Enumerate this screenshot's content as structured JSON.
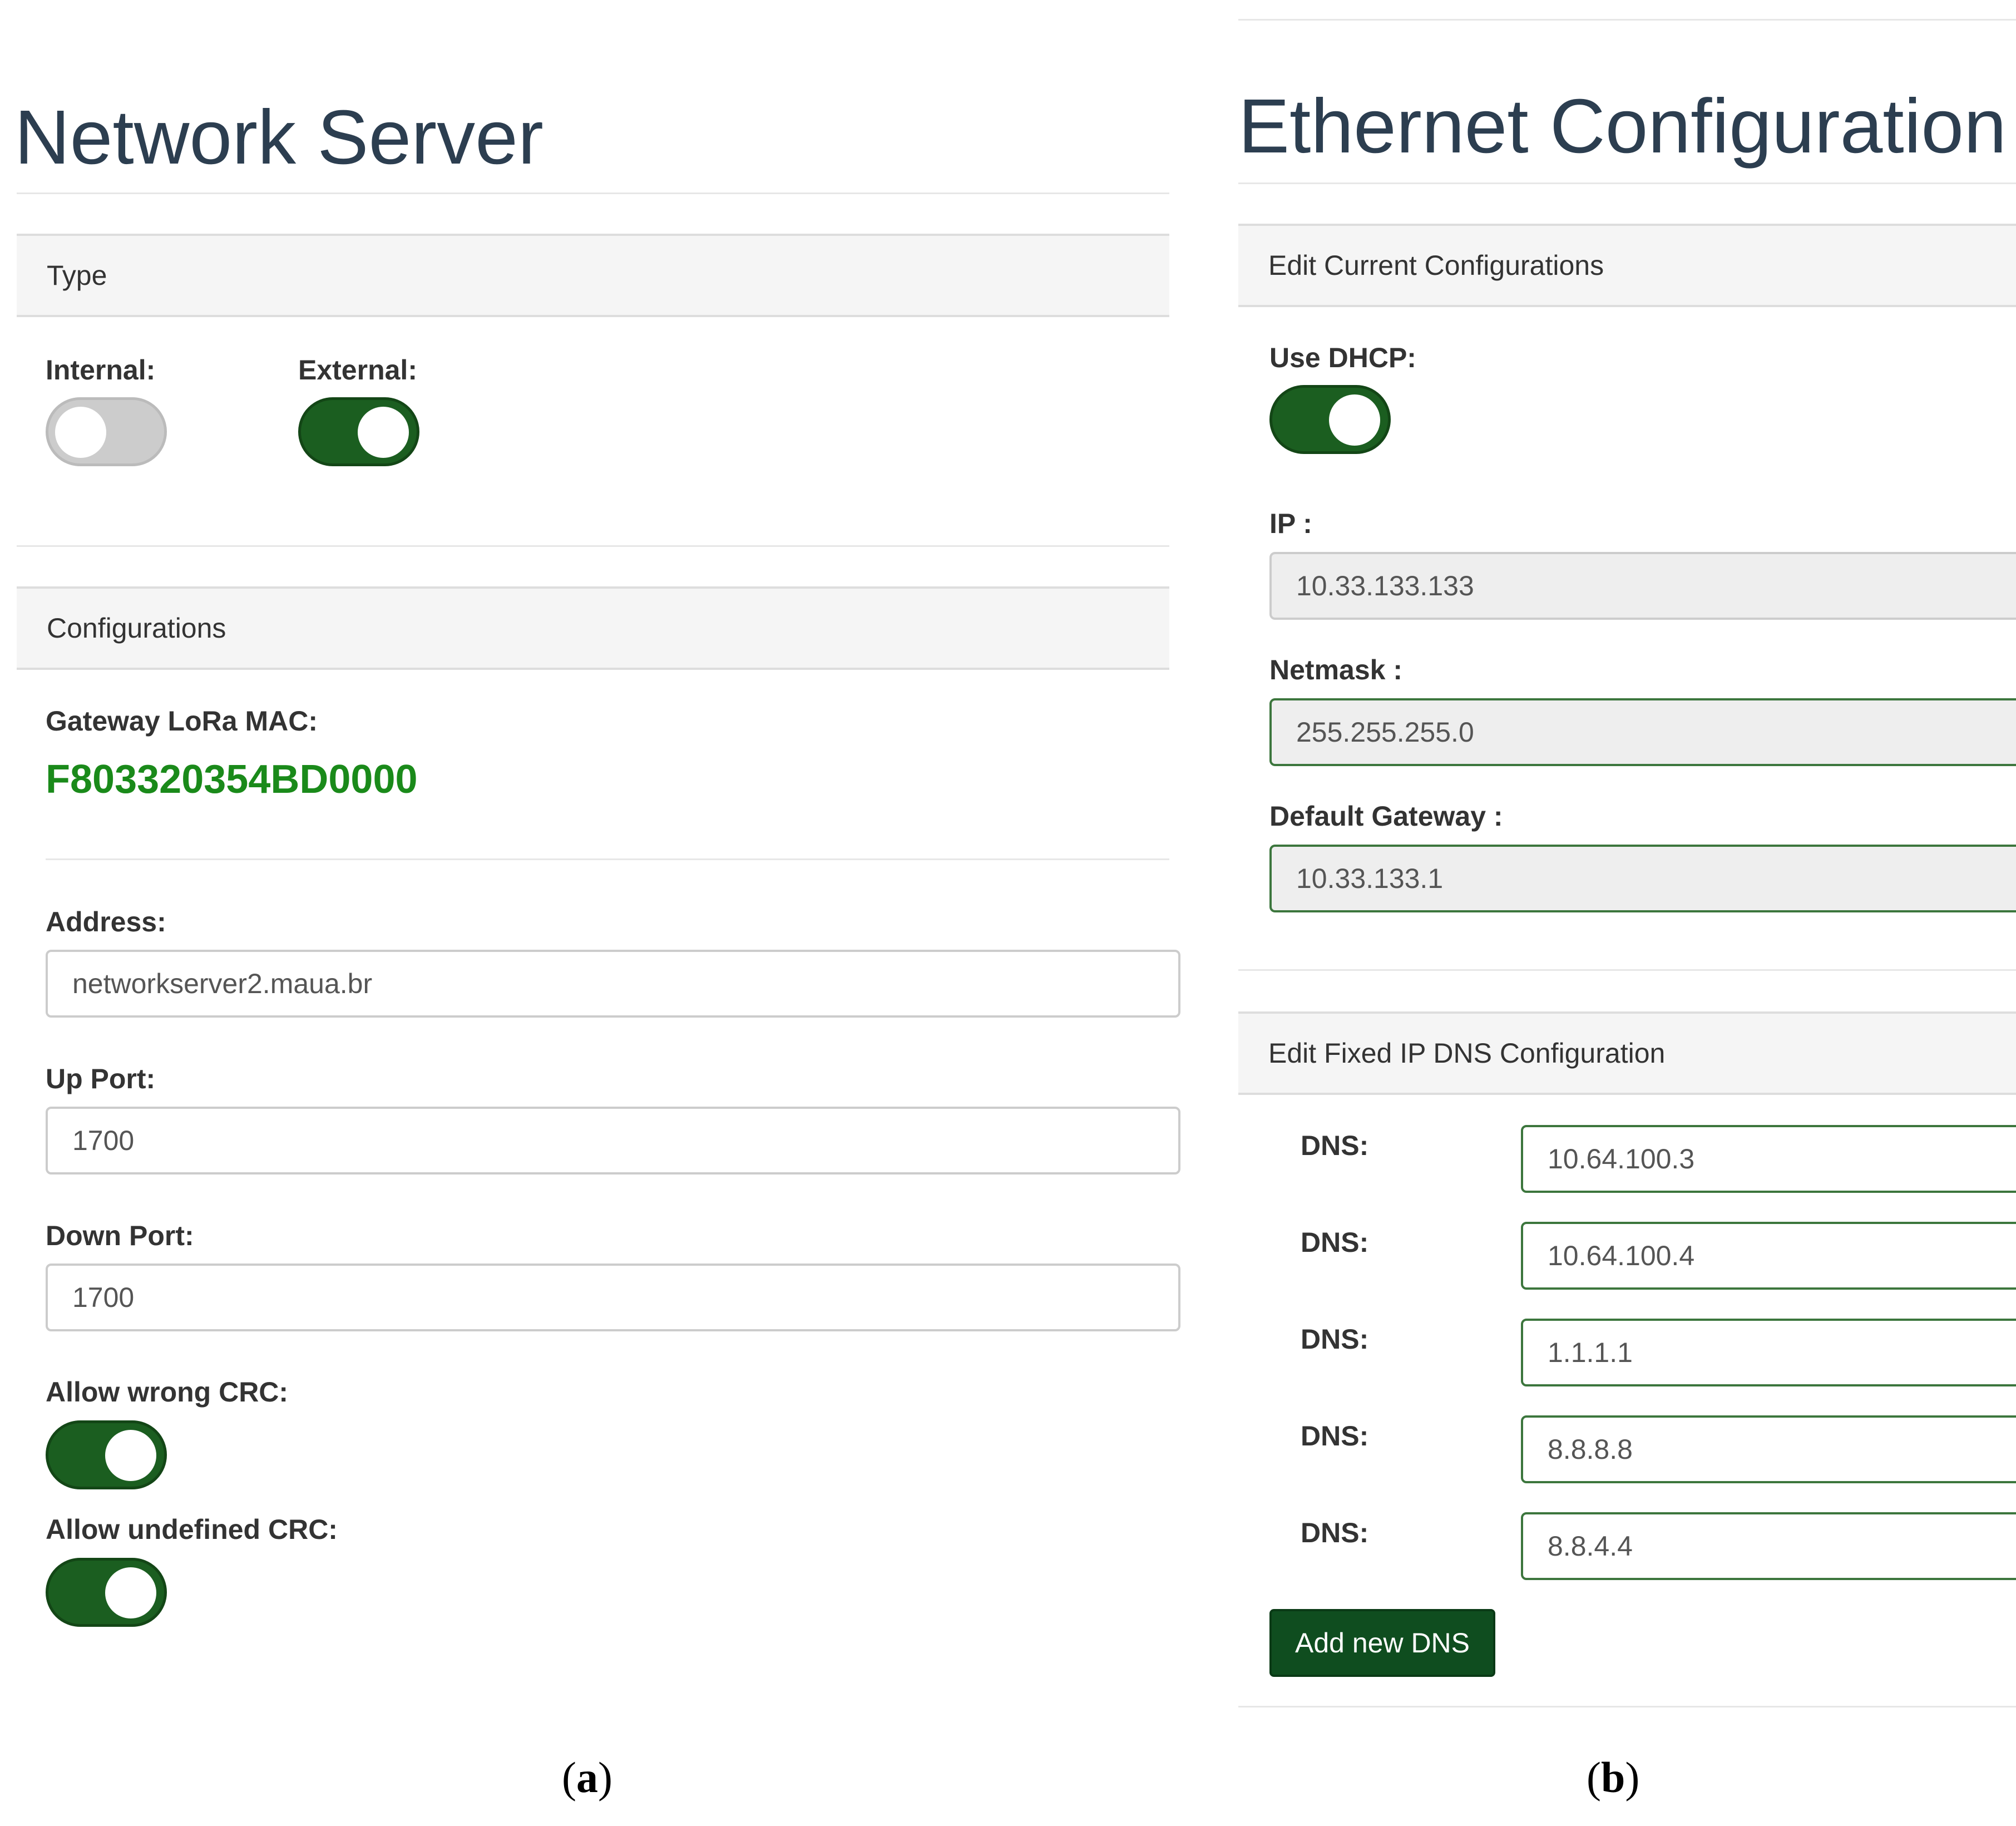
{
  "panel_a": {
    "title": "Network Server",
    "type_section": {
      "heading": "Type",
      "internal_label": "Internal:",
      "external_label": "External:",
      "internal_on": false,
      "external_on": true
    },
    "config_section": {
      "heading": "Configurations",
      "mac_label": "Gateway LoRa MAC:",
      "mac_value": "F803320354BD0000",
      "address_label": "Address:",
      "address_value": "networkserver2.maua.br",
      "up_port_label": "Up Port:",
      "up_port_value": "1700",
      "down_port_label": "Down Port:",
      "down_port_value": "1700",
      "wrong_crc_label": "Allow wrong CRC:",
      "wrong_crc_on": true,
      "undefined_crc_label": "Allow undefined CRC:",
      "undefined_crc_on": true
    },
    "caption_open": "(",
    "caption_letter": "a",
    "caption_close": ")"
  },
  "panel_b": {
    "title": "Ethernet Configuration",
    "current_section": {
      "heading": "Edit Current Configurations",
      "dhcp_label": "Use DHCP:",
      "dhcp_on": true,
      "ip_label": "IP :",
      "ip_value": "10.33.133.133",
      "netmask_label": "Netmask :",
      "netmask_value": "255.255.255.0",
      "gateway_label": "Default Gateway :",
      "gateway_value": "10.33.133.1"
    },
    "dns_section": {
      "heading": "Edit Fixed IP DNS Configuration",
      "entries": [
        {
          "label": "DNS:",
          "value": "10.64.100.3"
        },
        {
          "label": "DNS:",
          "value": "10.64.100.4"
        },
        {
          "label": "DNS:",
          "value": "1.1.1.1"
        },
        {
          "label": "DNS:",
          "value": "8.8.8.8"
        },
        {
          "label": "DNS:",
          "value": "8.8.4.4"
        }
      ],
      "add_button": "Add new DNS"
    },
    "caption_open": "(",
    "caption_letter": "b",
    "caption_close": ")"
  },
  "colors": {
    "toggle_on": "#1b5e20",
    "toggle_off": "#cccccc",
    "mac_text": "#1a8a1a",
    "button": "#0f4d1f",
    "valid_border": "#3c763d",
    "title_text": "#2c3e50"
  }
}
